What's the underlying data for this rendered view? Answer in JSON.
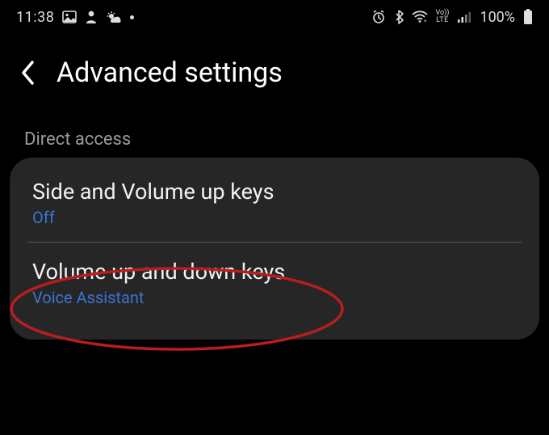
{
  "status": {
    "time": "11:38",
    "battery_pct": "100%",
    "network_label_top": "Vo))",
    "network_label_bottom": "LTE"
  },
  "header": {
    "title": "Advanced settings"
  },
  "section": {
    "label": "Direct access",
    "items": [
      {
        "title": "Side and Volume up keys",
        "subtitle": "Off"
      },
      {
        "title": "Volume up and down keys",
        "subtitle": "Voice Assistant"
      }
    ]
  },
  "annotation": {
    "highlight": "Volume up and down keys",
    "color": "#b81e1e"
  },
  "icons": {
    "back": "chevron-left",
    "status_left": [
      "image-icon",
      "person-icon",
      "weather-icon",
      "dot"
    ],
    "status_right": [
      "alarm-icon",
      "bluetooth-icon",
      "wifi-icon",
      "volte-indicator",
      "signal-icon",
      "battery-icon"
    ]
  }
}
